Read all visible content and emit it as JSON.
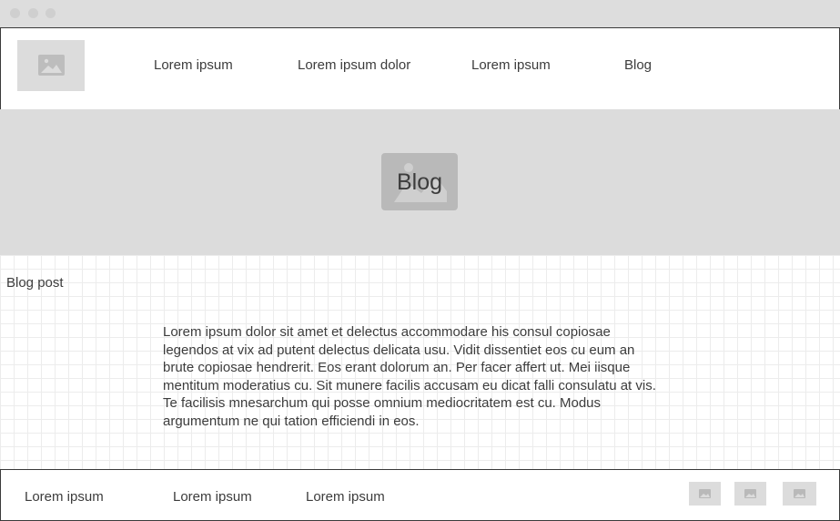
{
  "nav": {
    "links": [
      "Lorem ipsum",
      "Lorem ipsum dolor",
      "Lorem ipsum",
      "Blog"
    ]
  },
  "hero": {
    "title": "Blog"
  },
  "content": {
    "section_label": "Blog post",
    "body": "Lorem ipsum dolor sit amet et delectus accommodare his consul copiosae legendos at vix ad putent delectus delicata usu. Vidit dissentiet eos cu eum an brute copiosae hendrerit. Eos erant dolorum an. Per facer affert ut. Mei iisque mentitum moderatius cu. Sit munere facilis accusam eu dicat falli consulatu at vis. Te facilisis mnesarchum qui posse omnium mediocritatem est cu. Modus argumentum ne qui tation efficiendi in eos."
  },
  "footer": {
    "links": [
      "Lorem ipsum",
      "Lorem ipsum",
      "Lorem ipsum"
    ]
  },
  "icons": {
    "logo": "image-placeholder-icon",
    "hero": "image-placeholder-icon",
    "social": [
      "image-placeholder-icon",
      "image-placeholder-icon",
      "image-placeholder-icon"
    ]
  },
  "colors": {
    "placeholder": "#dcdcdc",
    "hero_box": "#b9b9b9",
    "text": "#3c3c3c",
    "border": "#3a3a3a"
  }
}
